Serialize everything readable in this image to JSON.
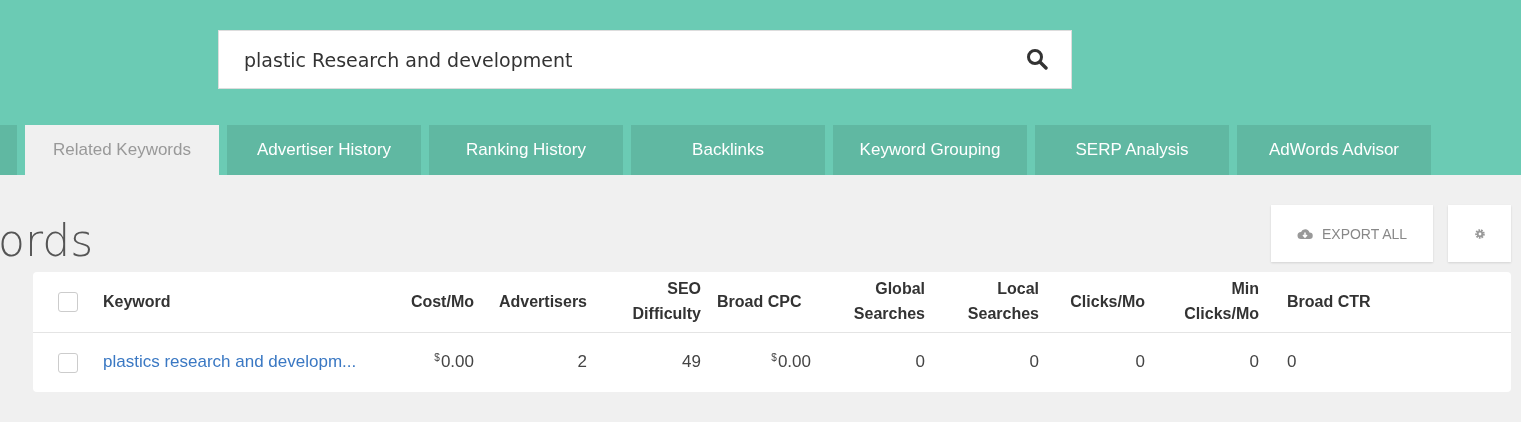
{
  "search": {
    "value": "plastic Research and development"
  },
  "tabs": [
    {
      "selected": false
    },
    {
      "label": "Related Keywords",
      "selected": true
    },
    {
      "label": "Advertiser History",
      "selected": false
    },
    {
      "label": "Ranking History",
      "selected": false
    },
    {
      "label": "Backlinks",
      "selected": false
    },
    {
      "label": "Keyword Grouping",
      "selected": false
    },
    {
      "label": "SERP Analysis",
      "selected": false
    },
    {
      "label": "AdWords Advisor",
      "selected": false
    }
  ],
  "heading": "ords",
  "export_button": "EXPORT ALL",
  "table": {
    "select_all_checked": false,
    "columns": [
      "Keyword",
      "Cost/Mo",
      "Advertisers",
      "SEO Difficulty",
      "Broad CPC",
      "Global Searches",
      "Local Searches",
      "Clicks/Mo",
      "Min Clicks/Mo",
      "Broad CTR"
    ],
    "rows": [
      {
        "checked": false,
        "cells": [
          {
            "kind": "link",
            "text": "plastics research and developm..."
          },
          {
            "kind": "money",
            "currency": "$",
            "amount": "0.00"
          },
          {
            "kind": "number",
            "text": "2"
          },
          {
            "kind": "number",
            "text": "49"
          },
          {
            "kind": "money",
            "currency": "$",
            "amount": "0.00"
          },
          {
            "kind": "number",
            "text": "0"
          },
          {
            "kind": "number",
            "text": "0"
          },
          {
            "kind": "number",
            "text": "0"
          },
          {
            "kind": "number",
            "text": "0"
          },
          {
            "kind": "number",
            "text": "0"
          }
        ]
      }
    ]
  }
}
